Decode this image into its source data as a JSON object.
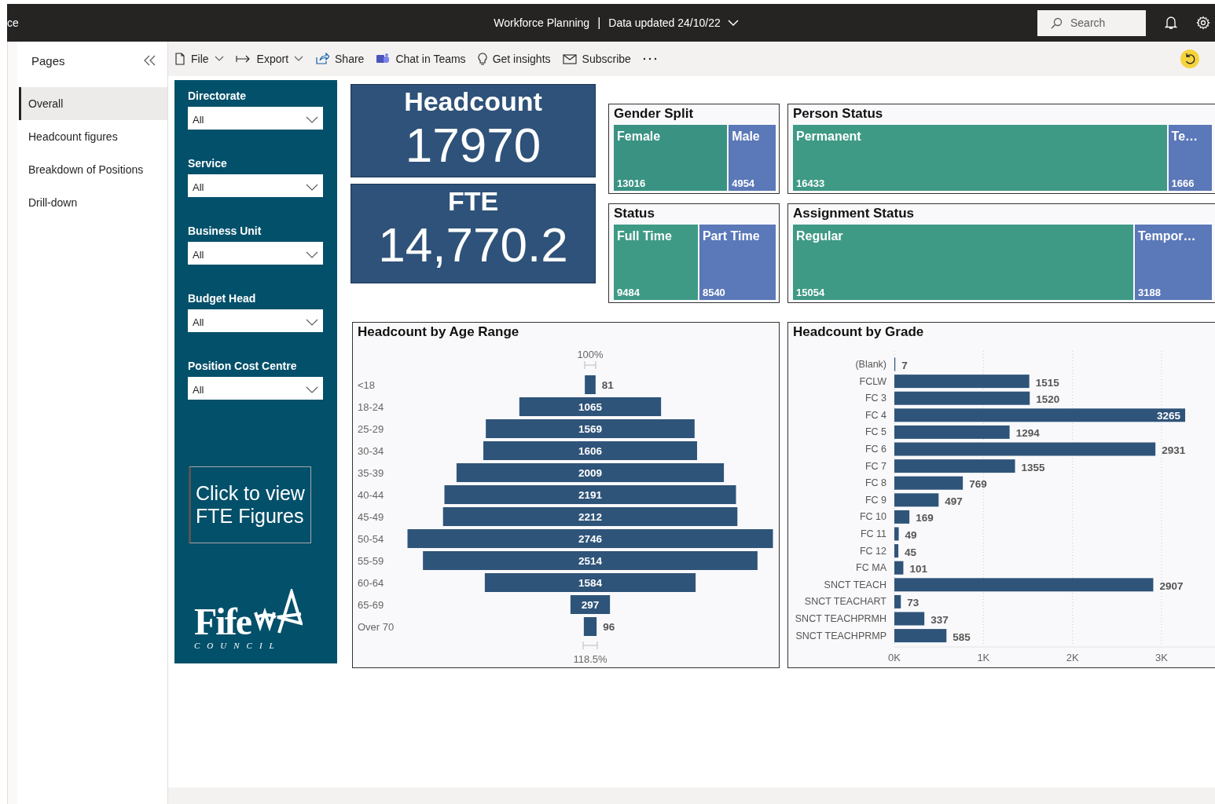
{
  "topbar": {
    "workspace_fragment": "ce",
    "title": "Workforce Planning",
    "separator": "|",
    "updated": "Data updated 24/10/22",
    "search": {
      "placeholder": "Search"
    }
  },
  "pages": {
    "title": "Pages",
    "items": [
      {
        "label": "Overall",
        "selected": true
      },
      {
        "label": "Headcount figures",
        "selected": false
      },
      {
        "label": "Breakdown of Positions",
        "selected": false
      },
      {
        "label": "Drill-down",
        "selected": false
      }
    ]
  },
  "toolbar": {
    "items": [
      {
        "label": "File",
        "kind": "menu"
      },
      {
        "label": "Export",
        "kind": "menu"
      },
      {
        "label": "Share",
        "kind": "action"
      },
      {
        "label": "Chat in Teams",
        "kind": "action"
      },
      {
        "label": "Get insights",
        "kind": "action"
      },
      {
        "label": "Subscribe",
        "kind": "action"
      }
    ]
  },
  "filters": [
    {
      "label": "Directorate",
      "value": "All"
    },
    {
      "label": "Service",
      "value": "All"
    },
    {
      "label": "Business Unit",
      "value": "All"
    },
    {
      "label": "Budget Head",
      "value": "All"
    },
    {
      "label": "Position Cost Centre",
      "value": "All"
    }
  ],
  "fte_button": "Click to view FTE Figures",
  "logo": {
    "name": "Fife",
    "sub": "COUNCIL"
  },
  "kpis": [
    {
      "label": "Headcount",
      "value": "17970"
    },
    {
      "label": "FTE",
      "value": "14,770.2"
    }
  ],
  "treemaps": [
    {
      "title": "Gender Split",
      "cells": [
        {
          "label": "Female",
          "value": "13016",
          "color": "#3a9283"
        },
        {
          "label": "Male",
          "value": "4954",
          "color": "#5b78b8"
        }
      ]
    },
    {
      "title": "Person Status",
      "cells": [
        {
          "label": "Permanent",
          "value": "16433",
          "color": "#3f9a85"
        },
        {
          "label": "Te…",
          "value": "1666",
          "color": "#5b78b8"
        }
      ]
    },
    {
      "title": "Status",
      "cells": [
        {
          "label": "Full Time",
          "value": "9484",
          "color": "#3f9a85"
        },
        {
          "label": "Part Time",
          "value": "8540",
          "color": "#5b78b8"
        }
      ]
    },
    {
      "title": "Assignment Status",
      "cells": [
        {
          "label": "Regular",
          "value": "15054",
          "color": "#3f9a85"
        },
        {
          "label": "Tempor…",
          "value": "3188",
          "color": "#5b78b8"
        }
      ]
    }
  ],
  "age_chart": {
    "title": "Headcount by Age Range",
    "top_label": "100%",
    "bottom_label": "118.5%",
    "stages": [
      {
        "label": "<18",
        "value": "81"
      },
      {
        "label": "18-24",
        "value": "1065"
      },
      {
        "label": "25-29",
        "value": "1569"
      },
      {
        "label": "30-34",
        "value": "1606"
      },
      {
        "label": "35-39",
        "value": "2009"
      },
      {
        "label": "40-44",
        "value": "2191"
      },
      {
        "label": "45-49",
        "value": "2212"
      },
      {
        "label": "50-54",
        "value": "2746"
      },
      {
        "label": "55-59",
        "value": "2514"
      },
      {
        "label": "60-64",
        "value": "1584"
      },
      {
        "label": "65-69",
        "value": "297"
      },
      {
        "label": "Over 70",
        "value": "96"
      }
    ]
  },
  "grade_chart": {
    "title": "Headcount by Grade",
    "chart_data": {
      "type": "bar",
      "orientation": "horizontal",
      "data_labels": true,
      "grid": true,
      "categories": [
        "(Blank)",
        "FCLW",
        "FC 3",
        "FC 4",
        "FC 5",
        "FC 6",
        "FC 7",
        "FC 8",
        "FC 9",
        "FC 10",
        "FC 11",
        "FC 12",
        "FC MA",
        "SNCT TEACH",
        "SNCT TEACHART",
        "SNCT TEACHPRMH",
        "SNCT TEACHPRMP"
      ],
      "values": [
        7,
        1515,
        1520,
        3265,
        1294,
        2931,
        1355,
        769,
        497,
        169,
        49,
        45,
        101,
        2907,
        73,
        337,
        585
      ],
      "xlim": [
        0,
        3600
      ],
      "xticks": [
        {
          "value": 0,
          "label": "0K"
        },
        {
          "value": 1000,
          "label": "1K"
        },
        {
          "value": 2000,
          "label": "2K"
        },
        {
          "value": 3000,
          "label": "3K"
        }
      ]
    }
  }
}
